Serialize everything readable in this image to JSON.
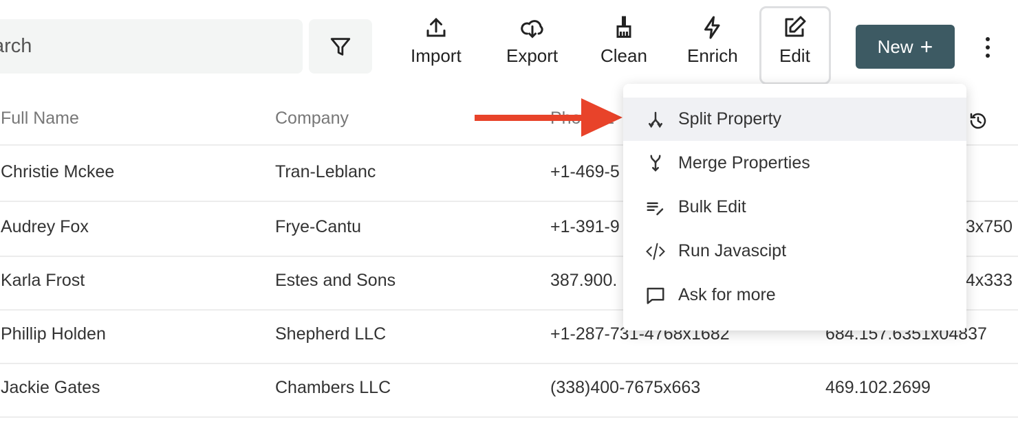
{
  "search": {
    "value": "arch"
  },
  "toolbar": {
    "items": [
      {
        "label": "Import",
        "icon": "upload-icon"
      },
      {
        "label": "Export",
        "icon": "cloud-download-icon"
      },
      {
        "label": "Clean",
        "icon": "broom-icon"
      },
      {
        "label": "Enrich",
        "icon": "lightning-icon"
      },
      {
        "label": "Edit",
        "icon": "edit-icon"
      }
    ],
    "new_label": "New",
    "accent": "#3d5a63"
  },
  "table": {
    "headers": [
      "Full Name",
      "Company",
      "Phone 1"
    ],
    "rows": [
      {
        "name": "Christie Mckee",
        "company": "Tran-Leblanc",
        "phone1": "+1-469-5",
        "phone2": ""
      },
      {
        "name": "Audrey Fox",
        "company": "Frye-Cantu",
        "phone1": "+1-391-9",
        "phone2": "3x750"
      },
      {
        "name": "Karla Frost",
        "company": "Estes and Sons",
        "phone1": "387.900.",
        "phone2": "4x333"
      },
      {
        "name": "Phillip Holden",
        "company": "Shepherd LLC",
        "phone1": "+1-287-731-4768x1682",
        "phone2": "684.157.6351x04837"
      },
      {
        "name": "Jackie Gates",
        "company": "Chambers LLC",
        "phone1": "(338)400-7675x663",
        "phone2": "469.102.2699"
      }
    ]
  },
  "menu": {
    "items": [
      {
        "label": "Split Property",
        "icon": "split-icon",
        "active": true
      },
      {
        "label": "Merge Properties",
        "icon": "merge-icon"
      },
      {
        "label": "Bulk Edit",
        "icon": "bulk-edit-icon"
      },
      {
        "label": "Run Javascipt",
        "icon": "code-icon"
      },
      {
        "label": "Ask for more",
        "icon": "chat-icon"
      }
    ]
  },
  "annotation": {
    "arrow_color": "#e8432a"
  }
}
